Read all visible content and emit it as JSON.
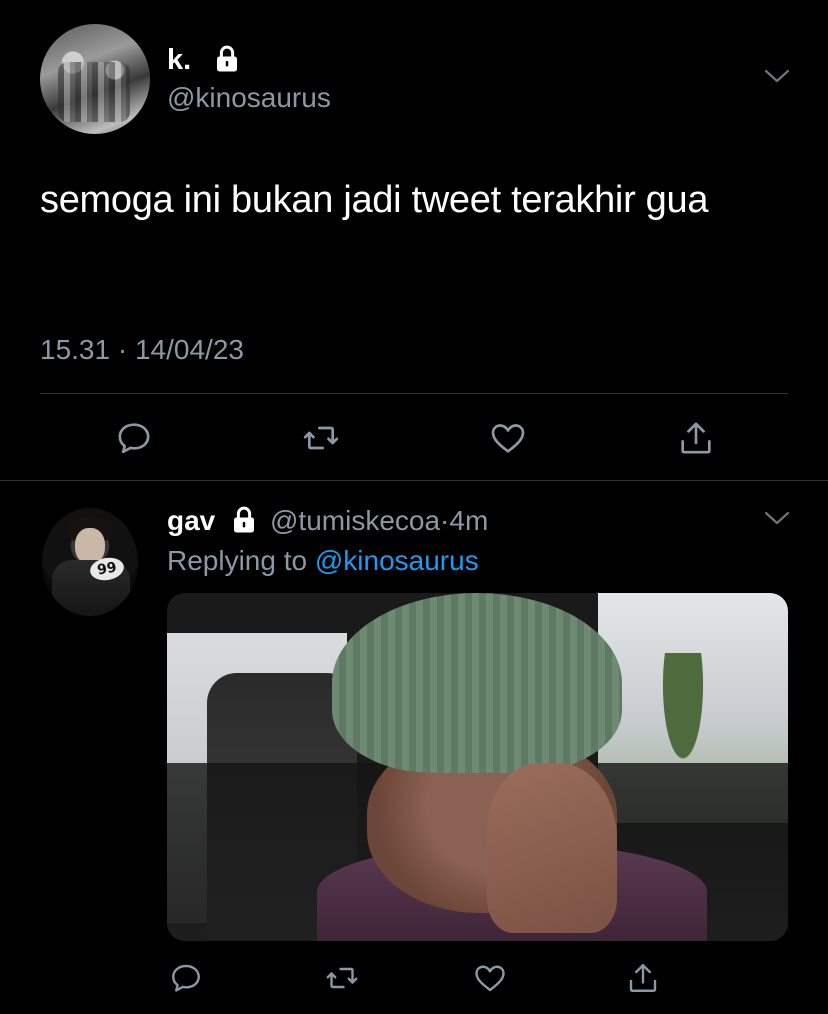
{
  "tweet": {
    "display_name": "k.",
    "handle": "@kinosaurus",
    "text": "semoga ini bukan jadi tweet terakhir gua",
    "time": "15.31",
    "separator": "·",
    "date": "14/04/23",
    "protected": true
  },
  "reply": {
    "display_name": "gav",
    "handle": "@tumiskecoa",
    "separator": "·",
    "age": "4m",
    "replying_prefix": "Replying to",
    "replying_to": "@kinosaurus",
    "avatar_jersey_number": "99",
    "protected": true
  },
  "actions": [
    "reply-icon",
    "retweet-icon",
    "like-icon",
    "share-icon"
  ],
  "colors": {
    "background": "#000000",
    "text": "#ffffff",
    "secondary": "#8b98a5",
    "link": "#1d9bf0",
    "divider": "#2f3336"
  }
}
